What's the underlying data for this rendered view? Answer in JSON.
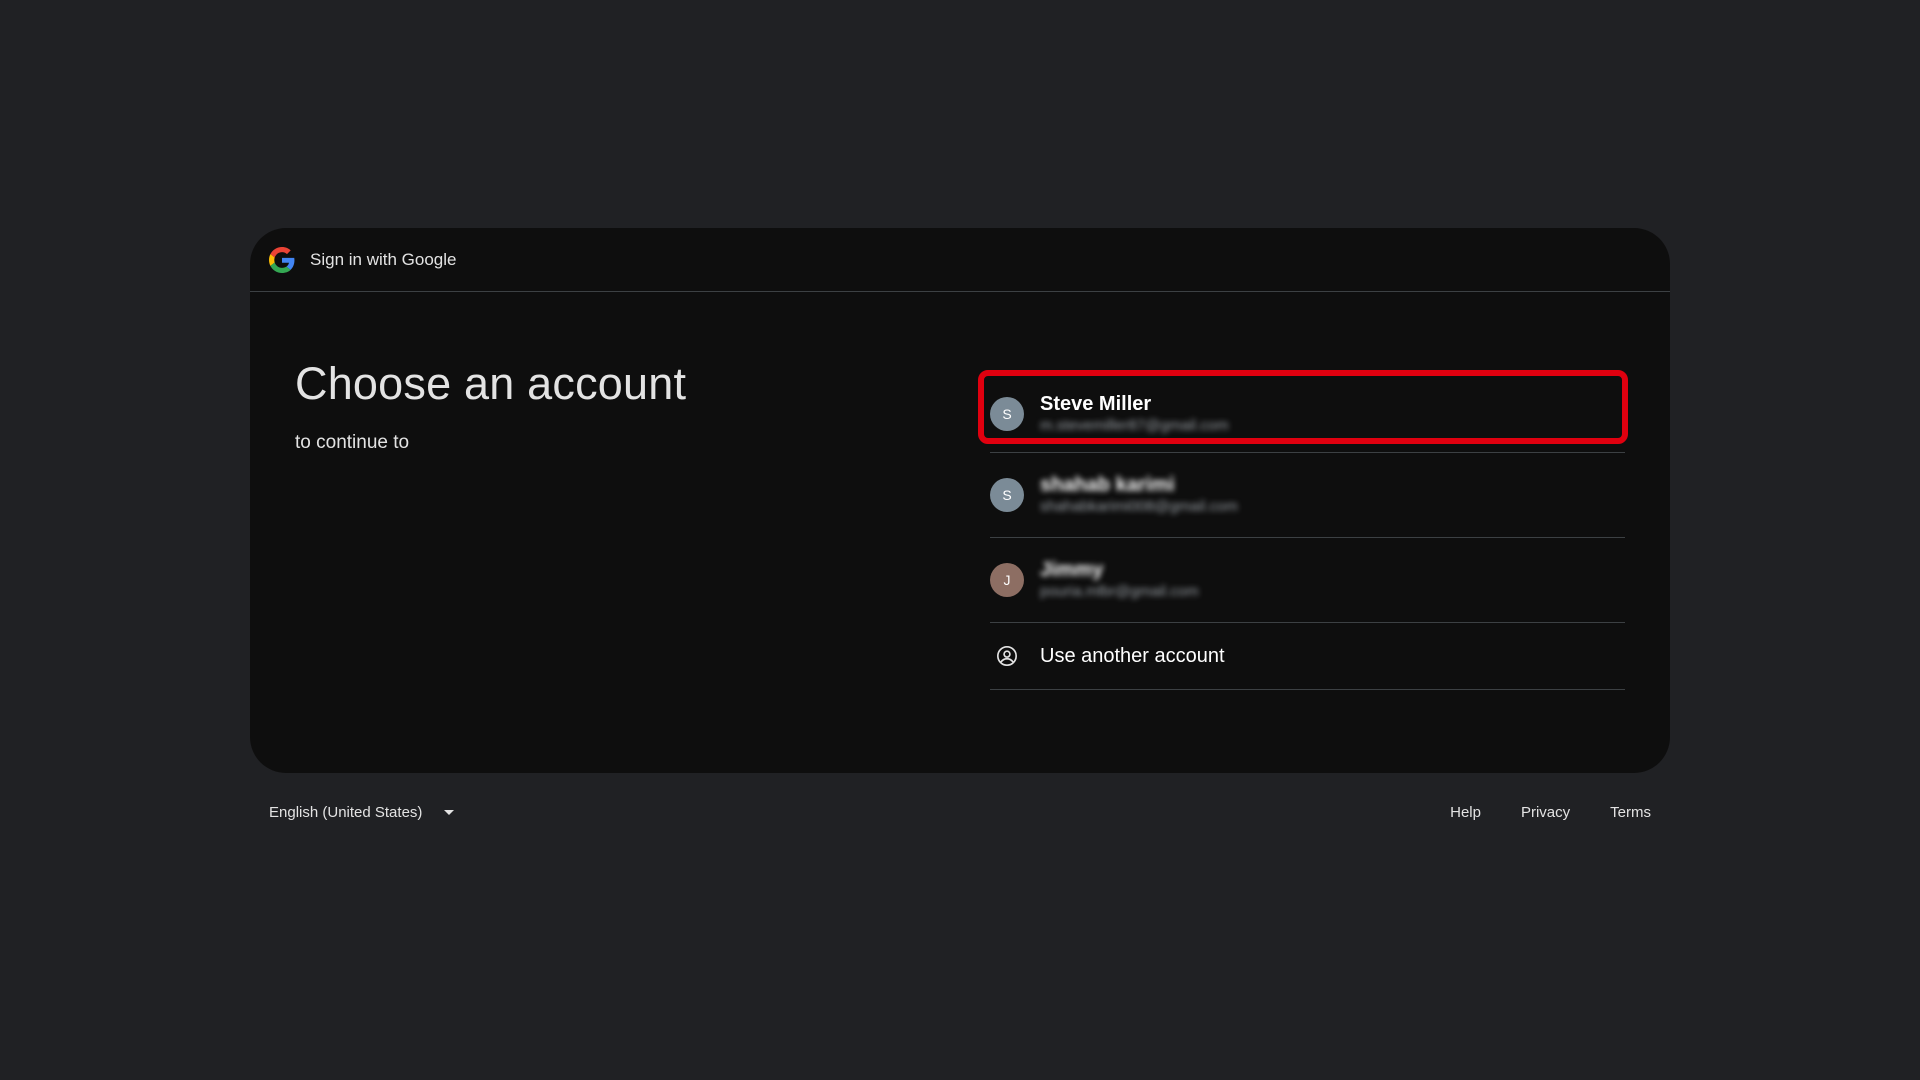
{
  "header": {
    "title": "Sign in with Google",
    "logo_icon": "google-g-logo"
  },
  "main": {
    "title": "Choose an account",
    "subtitle": "to continue to"
  },
  "accounts": [
    {
      "initial": "S",
      "name": "Steve Miller",
      "email": "m.stevemiller87@gmail.com",
      "avatar_color": "#7b8b97",
      "highlighted": true
    },
    {
      "initial": "S",
      "name": "shahab karimi",
      "email": "shahabkarimi008@gmail.com",
      "avatar_color": "#7b8b97",
      "highlighted": false
    },
    {
      "initial": "J",
      "name": "Jimmy",
      "email": "pouria.mlbr@gmail.com",
      "avatar_color": "#8d6e63",
      "highlighted": false
    }
  ],
  "use_another": {
    "label": "Use another account",
    "icon": "account-circle-icon"
  },
  "footer": {
    "language": "English (United States)",
    "help": "Help",
    "privacy": "Privacy",
    "terms": "Terms"
  },
  "colors": {
    "highlight_border": "#e0000f",
    "page_background": "#202124",
    "card_background": "#0e0e0e"
  }
}
